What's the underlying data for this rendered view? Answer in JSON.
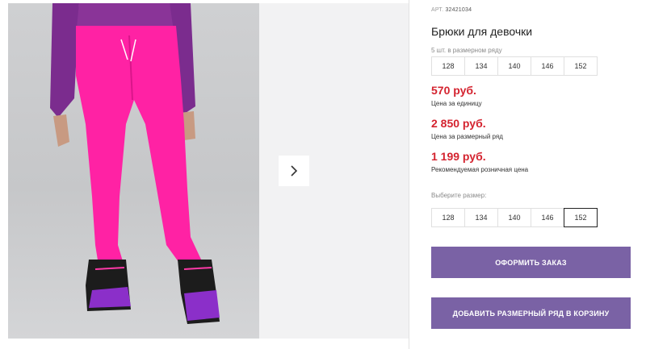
{
  "product": {
    "sku_label": "АРТ.",
    "sku_value": "32421034",
    "title": "Брюки для девочки",
    "image_alt": "product-photo"
  },
  "size_row": {
    "caption": "5 шт. в размерном ряду",
    "sizes": [
      "128",
      "134",
      "140",
      "146",
      "152"
    ]
  },
  "prices": [
    {
      "value": "570 руб.",
      "note": "Цена за единицу"
    },
    {
      "value": "2 850 руб.",
      "note": "Цена за размерный ряд"
    },
    {
      "value": "1 199 руб.",
      "note": "Рекомендуемая розничная цена"
    }
  ],
  "size_select": {
    "label": "Выберите размер:",
    "sizes": [
      "128",
      "134",
      "140",
      "146",
      "152"
    ],
    "selected": "152"
  },
  "buttons": {
    "order": "ОФОРМИТЬ ЗАКАЗ",
    "add_row": "ДОБАВИТЬ РАЗМЕРНЫЙ РЯД В КОРЗИНУ"
  },
  "colors": {
    "price": "#d4232f",
    "button": "#7a62a5",
    "pants": "#ff1fa0",
    "sleeve": "#7a2a8c"
  },
  "icons": {
    "next": "chevron-right-icon"
  }
}
